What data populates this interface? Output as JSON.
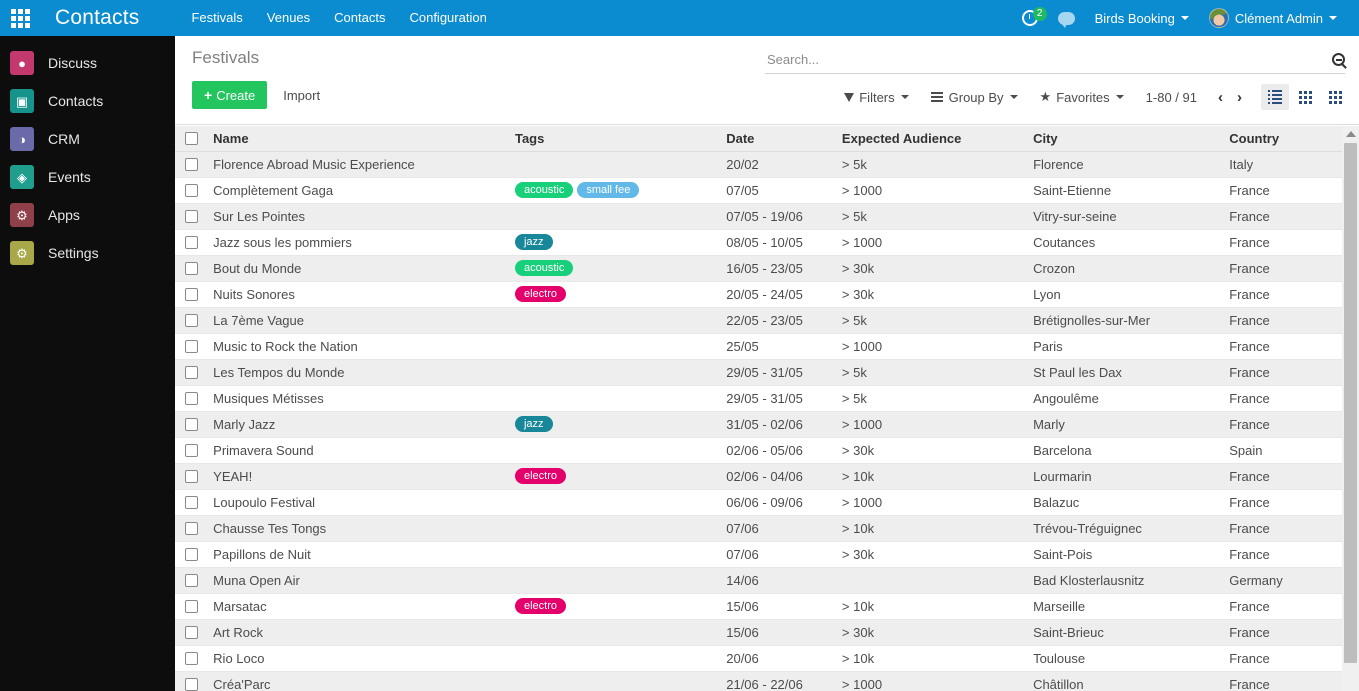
{
  "navbar": {
    "apps_icon": "apps-grid-icon",
    "brand": "Contacts",
    "menus": [
      "Festivals",
      "Venues",
      "Contacts",
      "Configuration"
    ],
    "activity": {
      "icon": "activity-clock-icon",
      "count": "2"
    },
    "messages_icon": "chat-bubble-icon",
    "company": "Birds Booking",
    "user": "Clément Admin",
    "background_color": "#0b8bd0"
  },
  "sidebar": {
    "items": [
      {
        "label": "Discuss",
        "icon": "discuss-icon",
        "glyph": "●",
        "color": "#c2386f"
      },
      {
        "label": "Contacts",
        "icon": "contacts-icon",
        "glyph": "▣",
        "color": "#16938a"
      },
      {
        "label": "CRM",
        "icon": "crm-icon",
        "glyph": "◑",
        "color": "#6a6aa8"
      },
      {
        "label": "Events",
        "icon": "events-icon",
        "glyph": "◈",
        "color": "#1f9e8e"
      },
      {
        "label": "Apps",
        "icon": "apps-icon",
        "glyph": "⚙",
        "color": "#8f4048"
      },
      {
        "label": "Settings",
        "icon": "settings-icon",
        "glyph": "⚙",
        "color": "#a8a84a"
      }
    ]
  },
  "control_panel": {
    "breadcrumb": "Festivals",
    "create_label": "Create",
    "create_plus": "+",
    "import_label": "Import",
    "search_placeholder": "Search...",
    "search_value": "",
    "search_icon": "search-icon",
    "filters_label": "Filters",
    "group_by_label": "Group By",
    "favorites_label": "Favorites",
    "favorites_glyph": "★",
    "pager": "1-80 / 91",
    "prev_glyph": "‹",
    "next_glyph": "›",
    "views": [
      {
        "name": "list-view-button",
        "active": true
      },
      {
        "name": "kanban-view-button",
        "active": false
      },
      {
        "name": "grid-view-button",
        "active": false
      }
    ],
    "create_color": "#22c55e"
  },
  "table": {
    "columns": [
      "Name",
      "Tags",
      "Date",
      "Expected Audience",
      "City",
      "Country"
    ],
    "tag_colors": {
      "acoustic": "#18d07a",
      "small fee": "#62b9e8",
      "jazz": "#18879a",
      "electro": "#e4006b"
    },
    "rows": [
      {
        "name": "Florence Abroad Music Experience",
        "tags": [],
        "date": "20/02",
        "audience": "> 5k",
        "city": "Florence",
        "country": "Italy"
      },
      {
        "name": "Complètement Gaga",
        "tags": [
          "acoustic",
          "small fee"
        ],
        "date": "07/05",
        "audience": "> 1000",
        "city": "Saint-Etienne",
        "country": "France"
      },
      {
        "name": "Sur Les Pointes",
        "tags": [],
        "date": "07/05 - 19/06",
        "audience": "> 5k",
        "city": "Vitry-sur-seine",
        "country": "France"
      },
      {
        "name": "Jazz sous les pommiers",
        "tags": [
          "jazz"
        ],
        "date": "08/05 - 10/05",
        "audience": "> 1000",
        "city": "Coutances",
        "country": "France"
      },
      {
        "name": "Bout du Monde",
        "tags": [
          "acoustic"
        ],
        "date": "16/05 - 23/05",
        "audience": "> 30k",
        "city": "Crozon",
        "country": "France"
      },
      {
        "name": "Nuits Sonores",
        "tags": [
          "electro"
        ],
        "date": "20/05 - 24/05",
        "audience": "> 30k",
        "city": "Lyon",
        "country": "France"
      },
      {
        "name": "La 7ème Vague",
        "tags": [],
        "date": "22/05 - 23/05",
        "audience": "> 5k",
        "city": "Brétignolles-sur-Mer",
        "country": "France"
      },
      {
        "name": "Music to Rock the Nation",
        "tags": [],
        "date": "25/05",
        "audience": "> 1000",
        "city": "Paris",
        "country": "France"
      },
      {
        "name": "Les Tempos du Monde",
        "tags": [],
        "date": "29/05 - 31/05",
        "audience": "> 5k",
        "city": "St Paul les Dax",
        "country": "France"
      },
      {
        "name": "Musiques Métisses",
        "tags": [],
        "date": "29/05 - 31/05",
        "audience": "> 5k",
        "city": "Angoulême",
        "country": "France"
      },
      {
        "name": "Marly Jazz",
        "tags": [
          "jazz"
        ],
        "date": "31/05 - 02/06",
        "audience": "> 1000",
        "city": "Marly",
        "country": "France"
      },
      {
        "name": "Primavera Sound",
        "tags": [],
        "date": "02/06 - 05/06",
        "audience": "> 30k",
        "city": "Barcelona",
        "country": "Spain"
      },
      {
        "name": "YEAH!",
        "tags": [
          "electro"
        ],
        "date": "02/06 - 04/06",
        "audience": "> 10k",
        "city": "Lourmarin",
        "country": "France"
      },
      {
        "name": "Loupoulo Festival",
        "tags": [],
        "date": "06/06 - 09/06",
        "audience": "> 1000",
        "city": "Balazuc",
        "country": "France"
      },
      {
        "name": "Chausse Tes Tongs",
        "tags": [],
        "date": "07/06",
        "audience": "> 10k",
        "city": "Trévou-Tréguignec",
        "country": "France"
      },
      {
        "name": "Papillons de Nuit",
        "tags": [],
        "date": "07/06",
        "audience": "> 30k",
        "city": "Saint-Pois",
        "country": "France"
      },
      {
        "name": "Muna Open Air",
        "tags": [],
        "date": "14/06",
        "audience": "",
        "city": "Bad Klosterlausnitz",
        "country": "Germany"
      },
      {
        "name": "Marsatac",
        "tags": [
          "electro"
        ],
        "date": "15/06",
        "audience": "> 10k",
        "city": "Marseille",
        "country": "France"
      },
      {
        "name": "Art Rock",
        "tags": [],
        "date": "15/06",
        "audience": "> 30k",
        "city": "Saint-Brieuc",
        "country": "France"
      },
      {
        "name": "Rio Loco",
        "tags": [],
        "date": "20/06",
        "audience": "> 10k",
        "city": "Toulouse",
        "country": "France"
      },
      {
        "name": "Créa'Parc",
        "tags": [],
        "date": "21/06 - 22/06",
        "audience": "> 1000",
        "city": "Châtillon",
        "country": "France"
      }
    ]
  }
}
